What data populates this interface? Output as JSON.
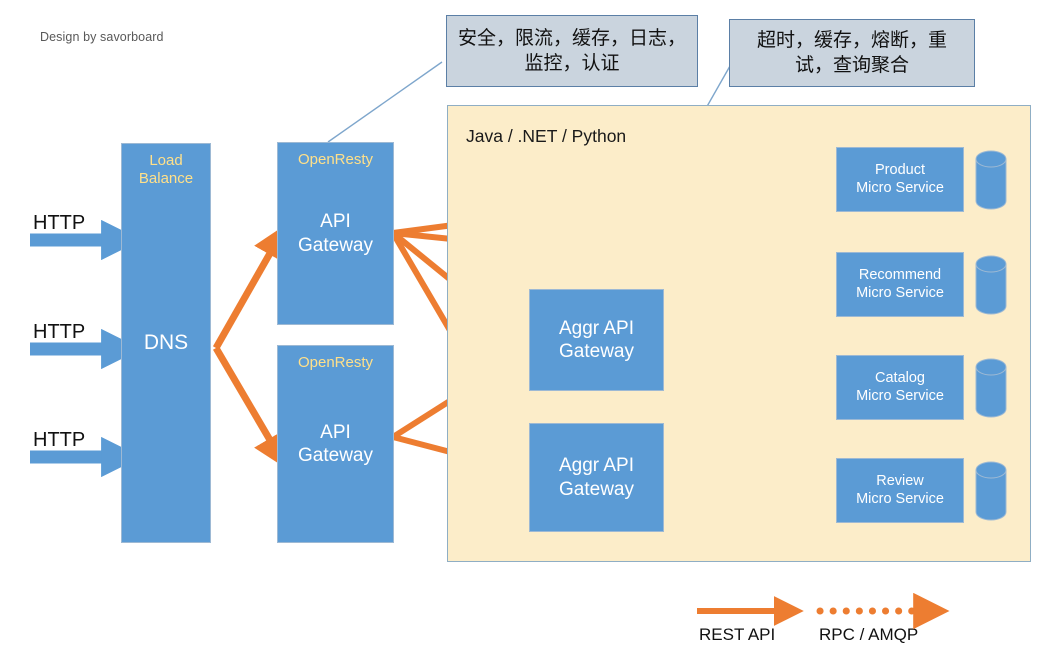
{
  "credit": "Design by savorboard",
  "colors": {
    "blue": "#5B9BD5",
    "blue_border": "#9DB9D4",
    "orange": "#ED7D31",
    "platform_bg": "#FCEDC9",
    "platform_border": "#8FAEC4",
    "callout_bg": "#CAD4DE",
    "callout_border": "#5B7FA6",
    "gold_text": "#FFE08A",
    "connector_line": "#7EA6CC"
  },
  "callouts": [
    {
      "id": "gateway-callout",
      "text": "安全，限流，缓存，日志，监控，认证"
    },
    {
      "id": "aggr-callout",
      "text": "超时，缓存，熔断，重试，查询聚合"
    }
  ],
  "entry": {
    "http_labels": [
      "HTTP",
      "HTTP",
      "HTTP"
    ]
  },
  "dns_column": {
    "sub_label": "Load\nBalance",
    "main_label": "DNS"
  },
  "gateways": [
    {
      "sub_label": "OpenResty",
      "main_label": "API\nGateway"
    },
    {
      "sub_label": "OpenResty",
      "main_label": "API\nGateway"
    }
  ],
  "platform": {
    "title": "Java / .NET / Python"
  },
  "aggregators": [
    {
      "main_label": "Aggr API\nGateway"
    },
    {
      "main_label": "Aggr API\nGateway"
    }
  ],
  "microservices": [
    {
      "main_label": "Product\nMicro Service",
      "has_database": true
    },
    {
      "main_label": "Recommend\nMicro Service",
      "has_database": true
    },
    {
      "main_label": "Catalog\nMicro Service",
      "has_database": true
    },
    {
      "main_label": "Review\nMicro Service",
      "has_database": true
    }
  ],
  "legend": [
    {
      "label": "REST API",
      "style": "solid"
    },
    {
      "label": "RPC / AMQP",
      "style": "dotted"
    }
  ]
}
